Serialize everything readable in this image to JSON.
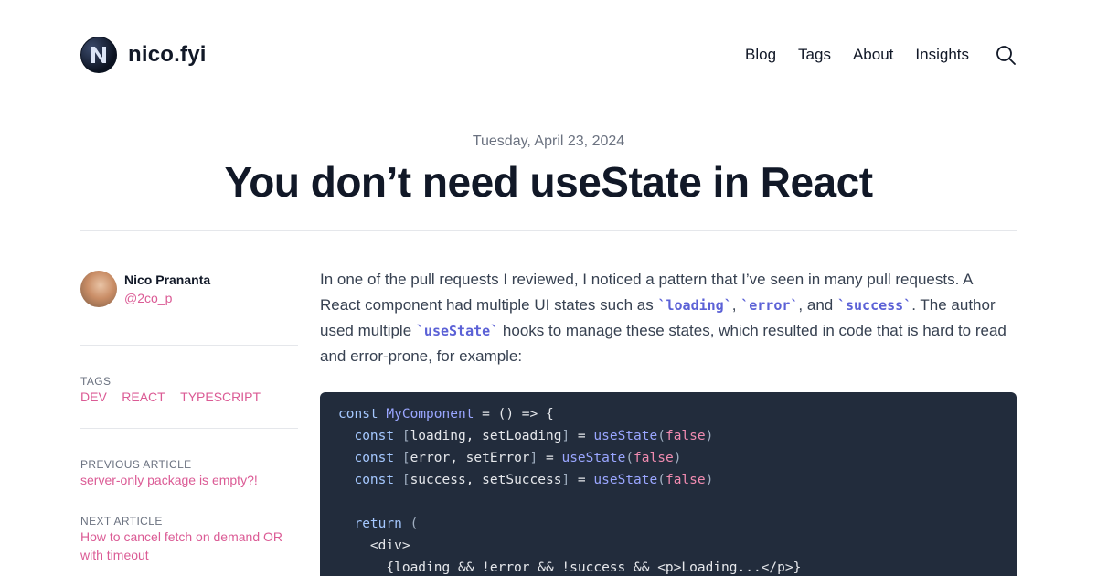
{
  "site": {
    "name": "nico.fyi"
  },
  "nav": {
    "items": [
      "Blog",
      "Tags",
      "About",
      "Insights"
    ]
  },
  "article": {
    "date": "Tuesday, April 23, 2024",
    "title": "You don’t need useState in React"
  },
  "author": {
    "name": "Nico Prananta",
    "handle": "@2co_p"
  },
  "tags": {
    "label": "TAGS",
    "items": [
      "DEV",
      "REACT",
      "TYPESCRIPT"
    ]
  },
  "previous": {
    "label": "PREVIOUS ARTICLE",
    "title": "server-only package is empty?!"
  },
  "next": {
    "label": "NEXT ARTICLE",
    "title": "How to cancel fetch on demand OR with timeout"
  },
  "body": {
    "p1_a": "In one of the pull requests I reviewed, I noticed a pattern that I’ve seen in many pull requests. A React component had multiple UI states such as ",
    "code_loading": "`loading`",
    "sep1": ", ",
    "code_error": "`error`",
    "sep2": ", and ",
    "code_success": "`success`",
    "p1_b": ". The author used multiple ",
    "code_usestate": "`useState`",
    "p1_c": " hooks to manage these states, which resulted in code that is hard to read and error-prone, for example:"
  },
  "code": {
    "l1_kw": "const ",
    "l1_fn": "MyComponent",
    "l1_rest": " = () => {",
    "l2_kw": "  const ",
    "l2_b1": "[",
    "l2_pl": "loading, setLoading",
    "l2_b2": "]",
    "l2_eq": " = ",
    "l2_fn": "useState",
    "l2_p1": "(",
    "l2_val": "false",
    "l2_p2": ")",
    "l3_kw": "  const ",
    "l3_b1": "[",
    "l3_pl": "error, setError",
    "l3_b2": "]",
    "l3_eq": " = ",
    "l3_fn": "useState",
    "l3_p1": "(",
    "l3_val": "false",
    "l3_p2": ")",
    "l4_kw": "  const ",
    "l4_b1": "[",
    "l4_pl": "success, setSuccess",
    "l4_b2": "]",
    "l4_eq": " = ",
    "l4_fn": "useState",
    "l4_p1": "(",
    "l4_val": "false",
    "l4_p2": ")",
    "l6_kw": "  return ",
    "l6_p": "(",
    "l7": "    <div>",
    "l8": "      {loading && !error && !success && <p>Loading...</p>}"
  },
  "colors": {
    "accent": "#db5b95",
    "inline_code": "#5b61d6",
    "code_bg": "#222c3c"
  },
  "icons": {
    "logo": "logo-icon",
    "search": "search-icon"
  }
}
